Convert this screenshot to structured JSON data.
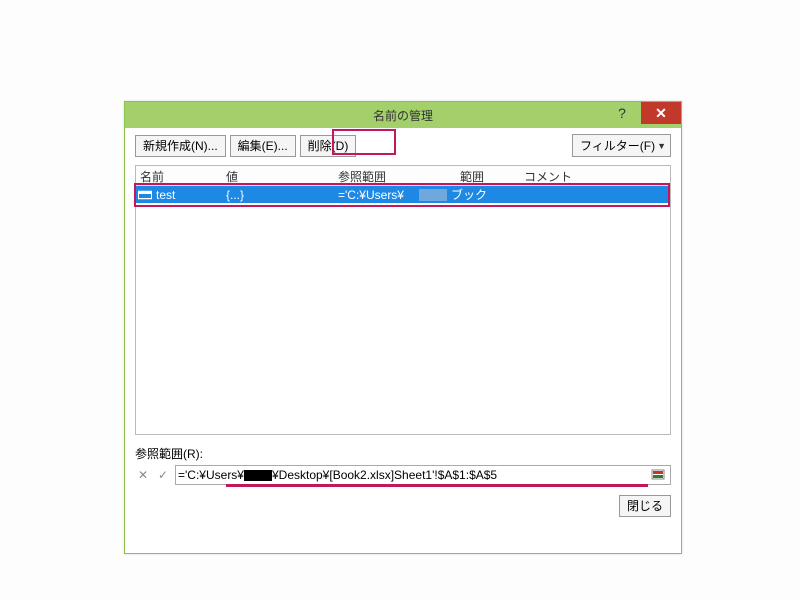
{
  "window": {
    "title": "名前の管理"
  },
  "toolbar": {
    "new_label": "新規作成(N)...",
    "edit_label": "編集(E)...",
    "delete_label": "削除(D)",
    "filter_label": "フィルター(F)"
  },
  "columns": {
    "name": "名前",
    "value": "値",
    "refers": "参照範囲",
    "scope": "範囲",
    "comment": "コメント"
  },
  "row": {
    "name": "test",
    "value": "{...}",
    "refers_prefix": "='C:¥Users¥",
    "scope": "ブック"
  },
  "ref": {
    "label": "参照範囲(R):",
    "value_prefix": "='C:¥Users¥",
    "value_suffix": "¥Desktop¥[Book2.xlsx]Sheet1'!$A$1:$A$5"
  },
  "footer": {
    "close_label": "閉じる"
  },
  "titlebar": {
    "help": "?"
  }
}
